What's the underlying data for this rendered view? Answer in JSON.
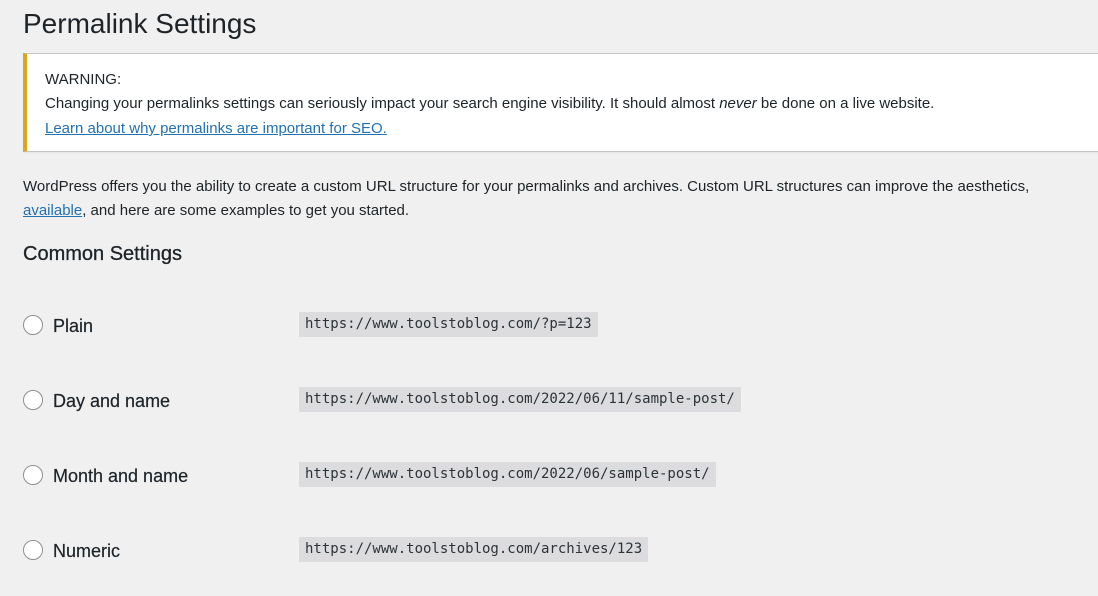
{
  "page": {
    "title": "Permalink Settings"
  },
  "notice": {
    "title": "WARNING:",
    "text_before": "Changing your permalinks settings can seriously impact your search engine visibility. It should almost ",
    "text_emphasis": "never",
    "text_after": " be done on a live website.",
    "link": "Learn about why permalinks are important for SEO."
  },
  "intro": {
    "line1": "WordPress offers you the ability to create a custom URL structure for your permalinks and archives. Custom URL structures can improve the aesthetics,",
    "link": "available",
    "line2_after": ", and here are some examples to get you started."
  },
  "common_settings": {
    "title": "Common Settings",
    "options": [
      {
        "label": "Plain",
        "example": "https://www.toolstoblog.com/?p=123"
      },
      {
        "label": "Day and name",
        "example": "https://www.toolstoblog.com/2022/06/11/sample-post/"
      },
      {
        "label": "Month and name",
        "example": "https://www.toolstoblog.com/2022/06/sample-post/"
      },
      {
        "label": "Numeric",
        "example": "https://www.toolstoblog.com/archives/123"
      }
    ]
  },
  "colors": {
    "background": "#f0f0f1",
    "warning_border": "#dba617",
    "link": "#2271b1",
    "code_background": "#dcdcde"
  }
}
